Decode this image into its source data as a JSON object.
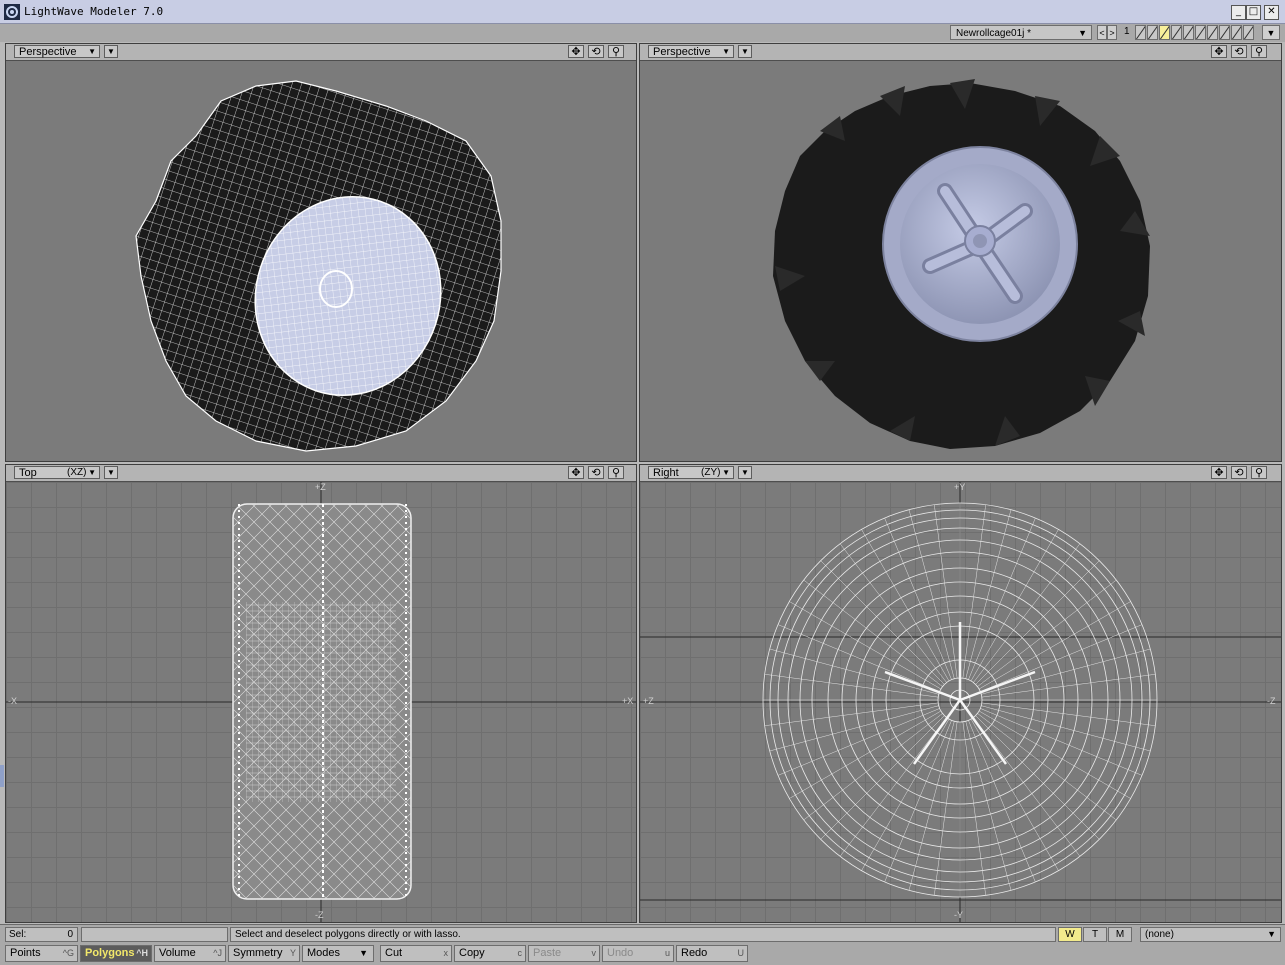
{
  "window": {
    "title": "LightWave Modeler 7.0",
    "minimize": "_",
    "maximize": "□",
    "close": "✕"
  },
  "topbar": {
    "object_name": "Newrollcage01j *",
    "prev": "<",
    "next": ">",
    "layer_number": "1",
    "active_layer": 3,
    "dropdown": "▼"
  },
  "viewports": {
    "tl": {
      "view": "Perspective",
      "mode_arrow": "▼"
    },
    "tr": {
      "view": "Perspective",
      "mode_arrow": "▼"
    },
    "bl": {
      "view": "Top",
      "axes": "(XZ)",
      "mode_arrow": "▼",
      "labels": {
        "top": "+Z",
        "bottom": "-Z",
        "left": "-X",
        "right": "+X"
      }
    },
    "br": {
      "view": "Right",
      "axes": "(ZY)",
      "mode_arrow": "▼",
      "labels": {
        "top": "+Y",
        "bottom": "-Y",
        "left": "+Z",
        "right": "-Z"
      }
    },
    "icons": {
      "move": "✥",
      "rotate": "⟲",
      "zoom": "⚲"
    }
  },
  "status": {
    "sel_label": "Sel:",
    "sel_value": "0",
    "hint": "Select and deselect polygons directly or with lasso.",
    "w": "W",
    "t": "T",
    "m": "M",
    "surface": "(none)"
  },
  "bottom": {
    "points": {
      "label": "Points",
      "key": "^G"
    },
    "polygons": {
      "label": "Polygons",
      "key": "^H"
    },
    "volume": {
      "label": "Volume",
      "key": "^J"
    },
    "symmetry": {
      "label": "Symmetry",
      "key": "Y"
    },
    "modes": {
      "label": "Modes"
    },
    "cut": {
      "label": "Cut",
      "key": "x"
    },
    "copy": {
      "label": "Copy",
      "key": "c"
    },
    "paste": {
      "label": "Paste",
      "key": "v"
    },
    "undo": {
      "label": "Undo",
      "key": "u"
    },
    "redo": {
      "label": "Redo",
      "key": "U"
    }
  },
  "colors": {
    "titlebar": "#c8cde4",
    "viewport_bg": "#7b7b7b",
    "active_button": "#5c5c5c",
    "highlight": "#f2ea8c"
  }
}
